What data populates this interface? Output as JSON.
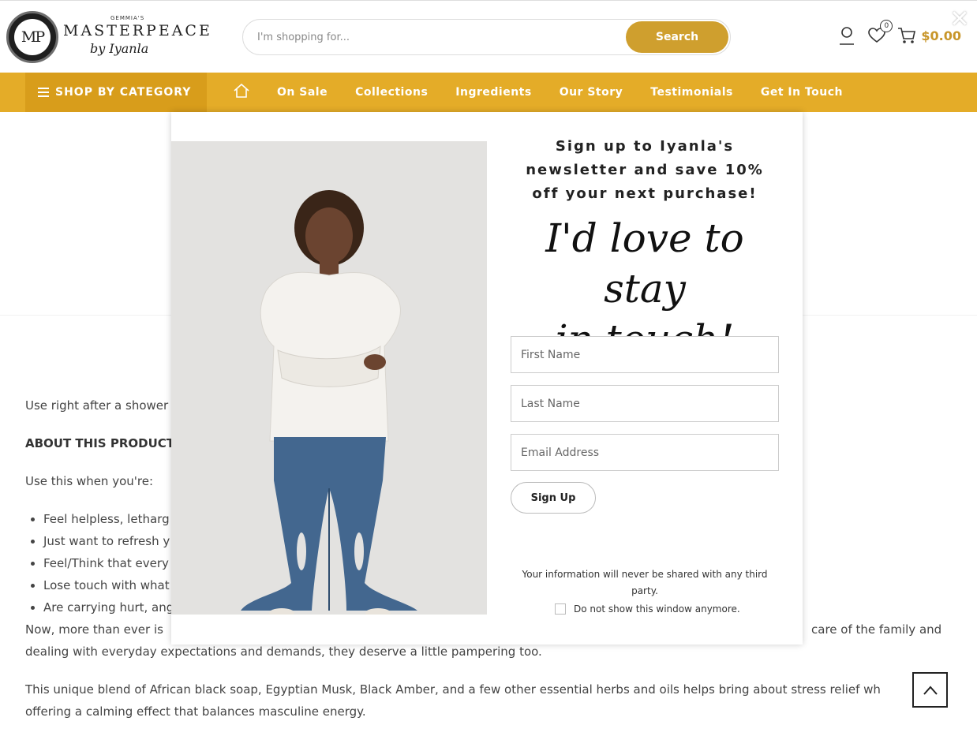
{
  "header": {
    "logo": {
      "seal": "MP",
      "small": "GEMMIA'S",
      "word": "MASTERPEACE",
      "signature": "by Iyanla"
    },
    "search": {
      "placeholder": "I'm shopping for...",
      "button_label": "Search"
    },
    "wishlist_count": "0",
    "cart_total": "$0.00"
  },
  "nav": {
    "category_label": "SHOP BY CATEGORY",
    "items": [
      "On Sale",
      "Collections",
      "Ingredients",
      "Our Story",
      "Testimonials",
      "Get In Touch"
    ]
  },
  "content": {
    "intro": "Use right after a shower",
    "heading": "ABOUT THIS PRODUCT",
    "lead": "Use this when you're:",
    "bullets": [
      "Feel helpless, letharg",
      "Just want to refresh y",
      "Feel/Think that every",
      "Lose touch with what",
      "Are carrying hurt, ang"
    ],
    "para1_a": "Now, more than ever is",
    "para1_b": "care of the family and",
    "para1_c": "dealing with everyday expectations and demands, they deserve a little pampering too.",
    "para2_a": "This unique blend of African black soap, Egyptian Musk, Black Amber, and a few other essential herbs and oils helps bring about stress relief wh",
    "para2_b": "offering a calming effect that balances masculine energy."
  },
  "modal": {
    "heading": "Sign up to Iyanla's newsletter and save 10% off your next purchase!",
    "script_line1": "I'd love to stay",
    "script_line2": "in touch!",
    "first_name_placeholder": "First Name",
    "last_name_placeholder": "Last Name",
    "email_placeholder": "Email Address",
    "signup_label": "Sign Up",
    "privacy_text": "Your information will never be shared with any third party.",
    "no_show_label": "Do not show this window anymore.",
    "close_symbol": "✕"
  },
  "colors": {
    "brand_gold": "#e4ac28",
    "brand_gold_dark": "#d89d1b",
    "search_button": "#cf9f2e"
  }
}
